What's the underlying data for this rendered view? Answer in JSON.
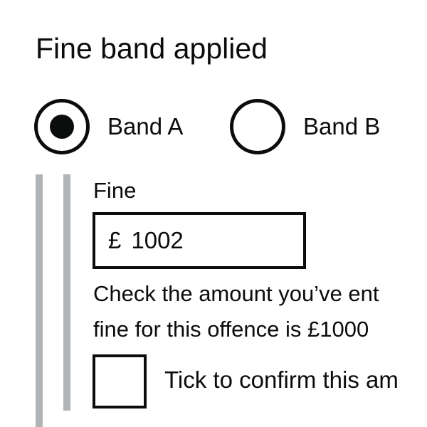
{
  "fieldset": {
    "legend": "Fine band applied"
  },
  "radios": {
    "band_a": {
      "label": "Band A",
      "checked": true
    },
    "band_b": {
      "label": "Band B",
      "checked": false
    }
  },
  "fine": {
    "label": "Fine",
    "currency_symbol": "£",
    "value": "1002"
  },
  "warning": {
    "line1": "Check the amount you’ve ent",
    "line2": "fine for this offence is £1000"
  },
  "confirm": {
    "label": "Tick to confirm this am",
    "checked": false
  }
}
